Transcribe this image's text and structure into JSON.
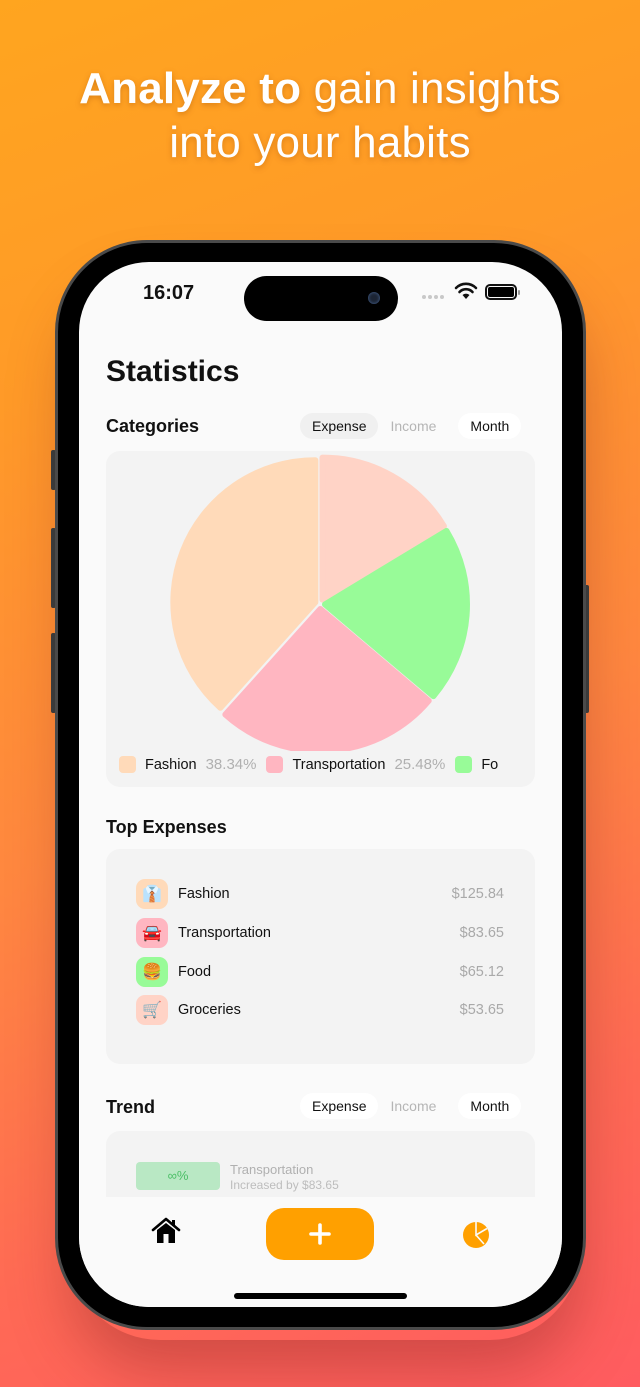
{
  "headline": {
    "bold": "Analyze to",
    "regular": " gain insights",
    "line2": "into your habits"
  },
  "status_bar": {
    "time": "16:07",
    "icons": [
      "cellular-dots-icon",
      "wifi-icon",
      "battery-icon"
    ]
  },
  "page": {
    "title": "Statistics"
  },
  "categories": {
    "title": "Categories",
    "segment": {
      "options": [
        "Expense",
        "Income"
      ],
      "selected": "Expense"
    },
    "period": "Month",
    "legend": [
      {
        "name": "Fashion",
        "percent": "38.34%",
        "color": "#ffdab9"
      },
      {
        "name": "Transportation",
        "percent": "25.48%",
        "color": "#ffb6c1"
      },
      {
        "name": "Fo",
        "percent": "",
        "color": "#98fb98"
      }
    ]
  },
  "chart_data": {
    "type": "pie",
    "title": "Categories",
    "slices": [
      {
        "label": "Fashion",
        "value": 38.34,
        "color": "#ffdab9"
      },
      {
        "label": "Transportation",
        "value": 25.48,
        "color": "#ffb6c1"
      },
      {
        "label": "Food",
        "value": 19.84,
        "color": "#98fb98"
      },
      {
        "label": "Groceries",
        "value": 16.34,
        "color": "#ffd3c6"
      }
    ],
    "units": "percent",
    "legend": "bottom"
  },
  "top_expenses": {
    "title": "Top Expenses",
    "items": [
      {
        "name": "Fashion",
        "amount": "$125.84",
        "emoji": "👔",
        "icon": "shirt-tie-icon",
        "color": "#ffdab9"
      },
      {
        "name": "Transportation",
        "amount": "$83.65",
        "emoji": "🚘",
        "icon": "car-icon",
        "color": "#ffb6c1"
      },
      {
        "name": "Food",
        "amount": "$65.12",
        "emoji": "🍔",
        "icon": "burger-icon",
        "color": "#98fb98"
      },
      {
        "name": "Groceries",
        "amount": "$53.65",
        "emoji": "🛒",
        "icon": "shopping-cart-icon",
        "color": "#ffd3c6"
      }
    ]
  },
  "trend": {
    "title": "Trend",
    "segment": {
      "options": [
        "Expense",
        "Income"
      ],
      "selected": "Expense"
    },
    "period": "Month",
    "items": [
      {
        "badge": "∞%",
        "category": "Transportation",
        "detail": "Increased by $83.65"
      }
    ]
  },
  "tab_bar": {
    "home": "home-icon",
    "add": "plus-icon",
    "stats": "pie-chart-icon",
    "accent": "#ffa000"
  }
}
